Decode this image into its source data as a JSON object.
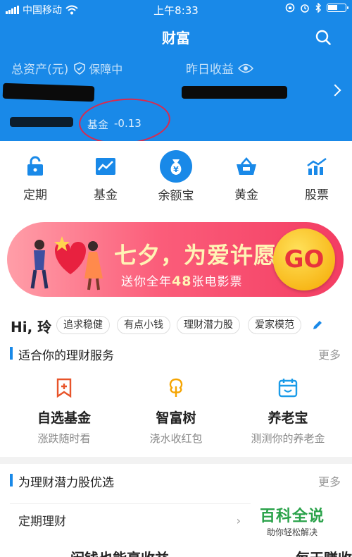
{
  "status_bar": {
    "carrier": "中国移动",
    "time": "上午8:33"
  },
  "header": {
    "title": "财富"
  },
  "assets": {
    "total_label": "总资产(元)",
    "protect_label": "保障中",
    "yesterday_label": "昨日收益",
    "fund_label": "基金",
    "fund_value": "-0.13"
  },
  "quick_nav": [
    {
      "label": "定期",
      "icon": "lock-icon"
    },
    {
      "label": "基金",
      "icon": "chart-icon"
    },
    {
      "label": "余额宝",
      "icon": "yuan-bag-icon"
    },
    {
      "label": "黄金",
      "icon": "gold-basket-icon"
    },
    {
      "label": "股票",
      "icon": "stock-chart-icon"
    }
  ],
  "banner": {
    "title": "七夕，为爱许愿",
    "subtitle_pre": "送你全年",
    "subtitle_num": "48",
    "subtitle_post": "张电影票",
    "go": "GO"
  },
  "hi": {
    "greeting": "Hi, 玲",
    "tags": [
      "追求稳健",
      "有点小钱",
      "理财潜力股",
      "爱家模范"
    ]
  },
  "section1": {
    "title": "适合你的理财服务",
    "more": "更多",
    "services": [
      {
        "title": "自选基金",
        "subtitle": "涨跌随时看",
        "icon": "bookmark-plus-icon"
      },
      {
        "title": "智富树",
        "subtitle": "浇水收红包",
        "icon": "tree-icon"
      },
      {
        "title": "养老宝",
        "subtitle": "测测你的养老金",
        "icon": "calendar-icon"
      }
    ]
  },
  "section2": {
    "title": "为理财潜力股优选",
    "more": "更多",
    "card_title": "定期理财",
    "card_headline": "闲钱也能享收益",
    "card2_headline": "每天赚收"
  },
  "watermark": {
    "title": "百科全说",
    "subtitle": "助你轻松解决"
  },
  "colors": {
    "brand_blue": "#1989e8",
    "red_circle": "#d92a4e",
    "banner_pink": "#f33d63",
    "go_yellow": "#ffc81e"
  }
}
